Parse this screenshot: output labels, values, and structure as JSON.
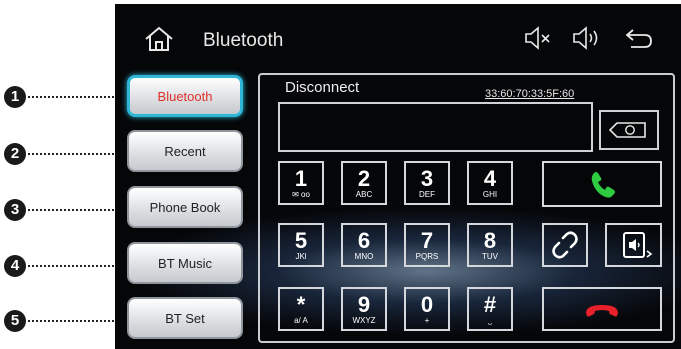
{
  "callouts": [
    "1",
    "2",
    "3",
    "4",
    "5"
  ],
  "header": {
    "title": "Bluetooth",
    "icons": [
      "home-icon",
      "mute-icon",
      "volume-icon",
      "back-arrow-icon"
    ]
  },
  "sidebar": {
    "items": [
      {
        "label": "Bluetooth",
        "active": true
      },
      {
        "label": "Recent",
        "active": false
      },
      {
        "label": "Phone Book",
        "active": false
      },
      {
        "label": "BT Music",
        "active": false
      },
      {
        "label": "BT Set",
        "active": false
      }
    ]
  },
  "status": "Disconnect",
  "device_address": "33:60:70:33:5F:60",
  "keypad": [
    {
      "digit": "1",
      "letters": "✉ oo"
    },
    {
      "digit": "2",
      "letters": "ABC"
    },
    {
      "digit": "3",
      "letters": "DEF"
    },
    {
      "digit": "4",
      "letters": "GHI"
    },
    {
      "digit": "5",
      "letters": "JKl"
    },
    {
      "digit": "6",
      "letters": "MNO"
    },
    {
      "digit": "7",
      "letters": "PQRS"
    },
    {
      "digit": "8",
      "letters": "TUV"
    },
    {
      "digit": "*",
      "letters": "a/ A"
    },
    {
      "digit": "9",
      "letters": "WXYZ"
    },
    {
      "digit": "0",
      "letters": "+"
    },
    {
      "digit": "#",
      "letters": "⎵"
    }
  ],
  "colors": {
    "accent": "#2fb7d8",
    "active_text": "#e0302a",
    "call": "#2ecc40",
    "hangup": "#e8202a"
  }
}
